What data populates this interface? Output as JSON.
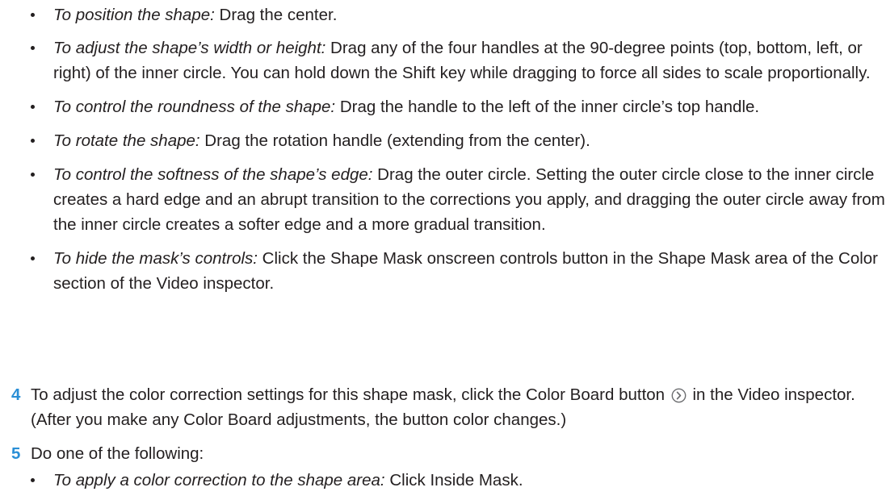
{
  "bullets": [
    {
      "lead": "To position the shape:",
      "text": " Drag the center."
    },
    {
      "lead": "To adjust the shape’s width or height:",
      "text": " Drag any of the four handles at the 90-degree points (top, bottom, left, or right) of the inner circle. You can hold down the Shift key while dragging to force all sides to scale proportionally."
    },
    {
      "lead": "To control the roundness of the shape:",
      "text": " Drag the handle to the left of the inner circle’s top handle."
    },
    {
      "lead": "To rotate the shape:",
      "text": " Drag the rotation handle (extending from the center)."
    },
    {
      "lead": "To control the softness of the shape’s edge:",
      "text": " Drag the outer circle. Setting the outer circle close to the inner circle creates a hard edge and an abrupt transition to the corrections you apply, and dragging the outer circle away from the inner circle creates a softer edge and a more gradual transition."
    },
    {
      "lead": "To hide the mask’s controls:",
      "text": " Click the Shape Mask onscreen controls button in the Shape Mask area of the Color section of the Video inspector."
    }
  ],
  "steps": [
    {
      "number": "4",
      "text_before": "To adjust the color correction settings for this shape mask, click the Color Board button",
      "text_after": " in the Video inspector. (After you make any Color Board adjustments, the button color changes.)"
    },
    {
      "number": "5",
      "text_before": "Do one of the following:",
      "text_after": ""
    }
  ],
  "sub_bullets": [
    {
      "lead": "To apply a color correction to the shape area:",
      "text": " Click Inside Mask."
    }
  ],
  "icons": {
    "color_board": "color-board-arrow-icon"
  },
  "colors": {
    "step_number": "#2a8fd6",
    "text": "#231f20"
  }
}
